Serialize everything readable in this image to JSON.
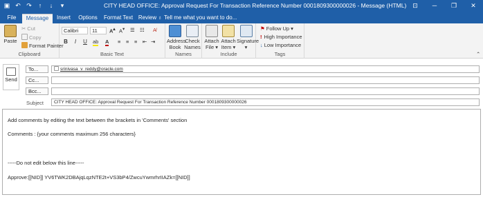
{
  "window": {
    "title": "CITY HEAD OFFICE: Approval Request For Transaction Reference Number 0001809300000026  -  Message (HTML)",
    "controls": [
      "restore",
      "minimize",
      "maximize",
      "close"
    ]
  },
  "tabs": [
    {
      "label": "File"
    },
    {
      "label": "Message"
    },
    {
      "label": "Insert"
    },
    {
      "label": "Options"
    },
    {
      "label": "Format Text"
    },
    {
      "label": "Review"
    }
  ],
  "tell_me": "Tell me what you want to do...",
  "ribbon": {
    "clipboard": {
      "label": "Clipboard",
      "paste": "Paste",
      "cut": "Cut",
      "copy": "Copy",
      "format_painter": "Format Painter"
    },
    "basic_text": {
      "label": "Basic Text",
      "font": "Calibri",
      "size": "11",
      "bold": "B",
      "italic": "I",
      "underline": "U"
    },
    "names": {
      "label": "Names",
      "address_book_1": "Address",
      "address_book_2": "Book",
      "check_names_1": "Check",
      "check_names_2": "Names"
    },
    "include": {
      "label": "Include",
      "attach_file_1": "Attach",
      "attach_file_2": "File ▾",
      "attach_item_1": "Attach",
      "attach_item_2": "Item ▾",
      "signature_1": "Signature",
      "signature_2": "▾"
    },
    "tags": {
      "label": "Tags",
      "follow_up": "Follow Up ▾",
      "high_importance": "High Importance",
      "low_importance": "Low Importance"
    }
  },
  "header": {
    "send": "Send",
    "to_label": "To...",
    "to_value": "srinivasa_v_reddy@oracle.com",
    "cc_label": "Cc...",
    "cc_value": "",
    "bcc_label": "Bcc...",
    "bcc_value": "",
    "subject_label": "Subject",
    "subject_value": "CITY HEAD OFFICE: Approval Request For Transaction Reference Number 0001809300000026"
  },
  "body": {
    "line1": "Add comments by editing the text between the brackets in 'Comments' section",
    "line2": "Comments : {your comments maximum 256 characters}",
    "line3": "-----Do not edit below this line-----",
    "line4": "Approve:[[NID]] YV6TWK2DBAjqLqzNTE2t+VS3bP4/ZwcuYwmrhrIIAZk=[[NID]]"
  },
  "colors": {
    "accent": "#1f5fa8",
    "ribbon_bg": "#f3f3f3"
  }
}
